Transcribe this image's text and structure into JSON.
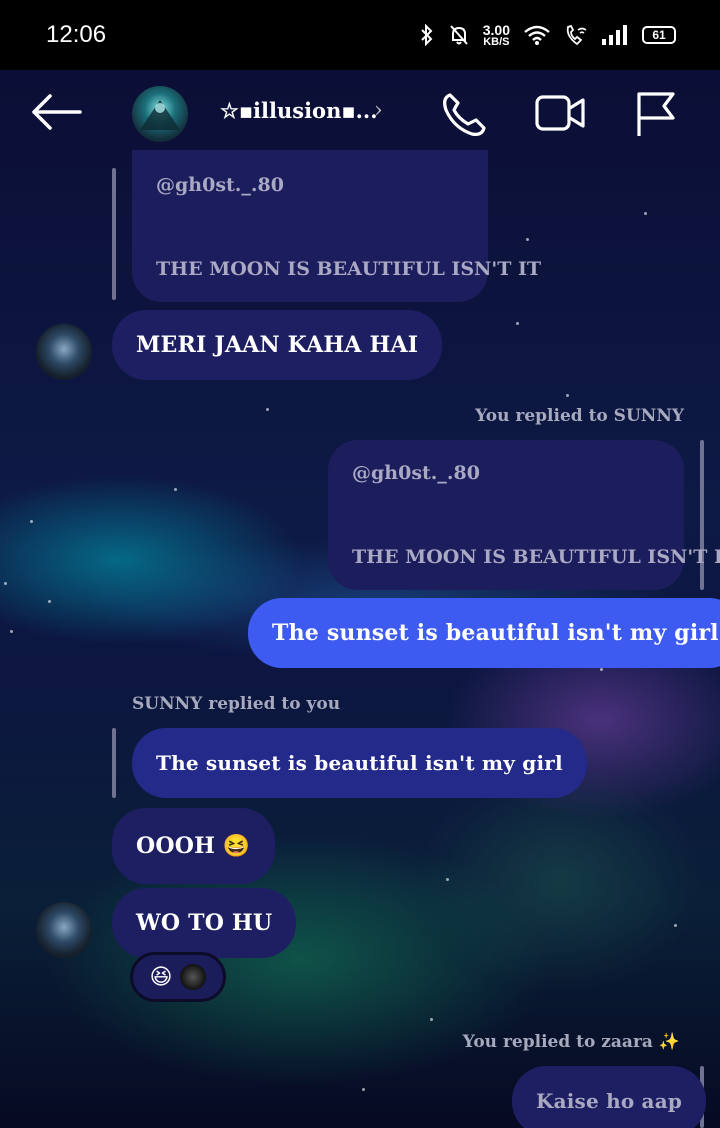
{
  "status_bar": {
    "time": "12:06",
    "net_speed": "3.00",
    "net_unit": "KB/S",
    "battery": "61"
  },
  "header": {
    "title": "☆▪illusion▪...",
    "chevron": "›"
  },
  "messages": {
    "quote1": {
      "user": "@gh0st._.80",
      "text": "THE MOON IS BEAUTIFUL ISN'T IT"
    },
    "msg1": "MERI JAAN KAHA HAI",
    "reply_label1": "You replied to SUNNY",
    "quote2": {
      "user": "@gh0st._.80",
      "text": "THE MOON IS BEAUTIFUL ISN'T IT"
    },
    "msg2": "The sunset is beautiful isn't my girl",
    "reply_label2": "SUNNY replied to you",
    "quote3_text": "The sunset is beautiful isn't my girl",
    "msg3": "OOOH 😆",
    "msg4": "WO TO HU",
    "reaction_emoji": "😆",
    "reply_label3": "You replied to zaara ✨",
    "msg5": "Kaise ho aap"
  },
  "icons": [
    "back-arrow-icon",
    "phone-icon",
    "video-icon",
    "flag-icon",
    "bluetooth-icon",
    "bell-off-icon",
    "wifi-icon",
    "wifi-call-icon",
    "signal-icon",
    "battery-icon"
  ]
}
